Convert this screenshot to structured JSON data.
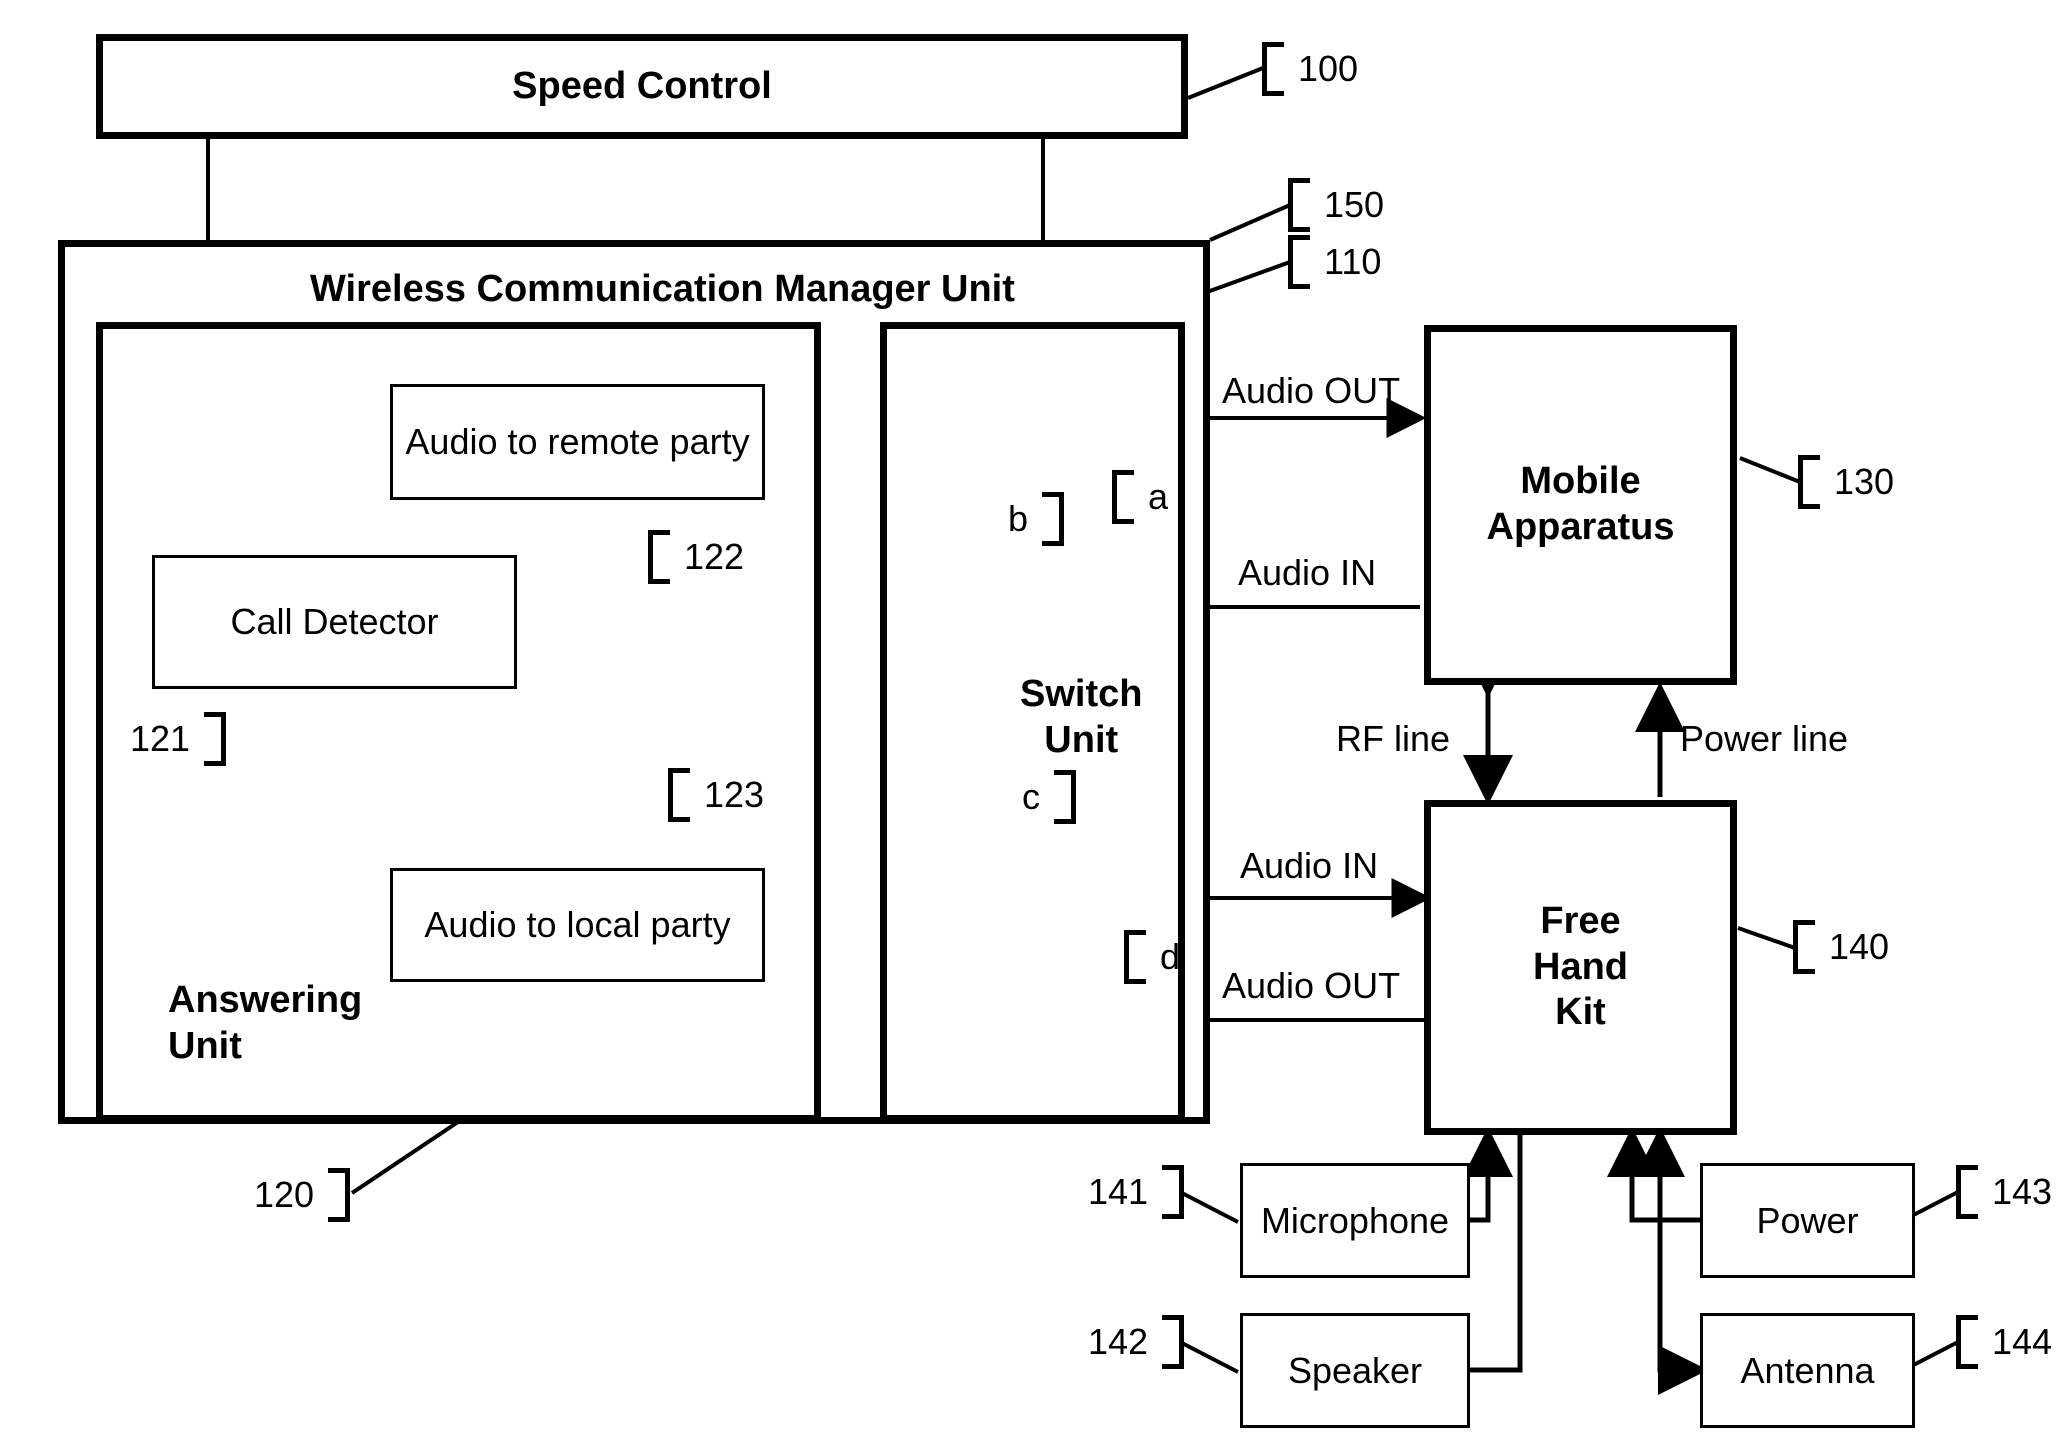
{
  "figure": {
    "type": "patent-block-diagram",
    "blocks": {
      "speed_control": "Speed Control",
      "wireless_manager": "Wireless Communication Manager Unit",
      "answering_unit": "Answering\nUnit",
      "answering_unit_line1": "Answering",
      "answering_unit_line2": "Unit",
      "switch_unit_line1": "Switch",
      "switch_unit_line2": "Unit",
      "call_detector": "Call Detector",
      "audio_remote": "Audio to remote party",
      "audio_local": "Audio to local party",
      "mobile_apparatus_line1": "Mobile",
      "mobile_apparatus_line2": "Apparatus",
      "free_hand_kit_line1": "Free",
      "free_hand_kit_line2": "Hand",
      "free_hand_kit_line3": "Kit",
      "microphone": "Microphone",
      "speaker": "Speaker",
      "power": "Power",
      "antenna": "Antenna"
    },
    "signal_labels": {
      "audio_out_mobile": "Audio OUT",
      "audio_in_mobile": "Audio IN",
      "audio_in_fhk": "Audio IN",
      "audio_out_fhk": "Audio OUT",
      "rf_line": "RF line",
      "power_line": "Power line"
    },
    "switch_labels": {
      "a": "a",
      "b": "b",
      "c": "c",
      "d": "d"
    },
    "reference_numerals": {
      "speed_control": "100",
      "switch_unit": "110",
      "answering_unit": "120",
      "call_detector": "121",
      "audio_remote": "122",
      "audio_local": "123",
      "mobile_apparatus": "130",
      "free_hand_kit": "140",
      "microphone": "141",
      "speaker": "142",
      "power": "143",
      "antenna": "144",
      "wireless_manager": "150"
    },
    "colors": {
      "ink": "#000000",
      "paper": "#ffffff"
    }
  }
}
